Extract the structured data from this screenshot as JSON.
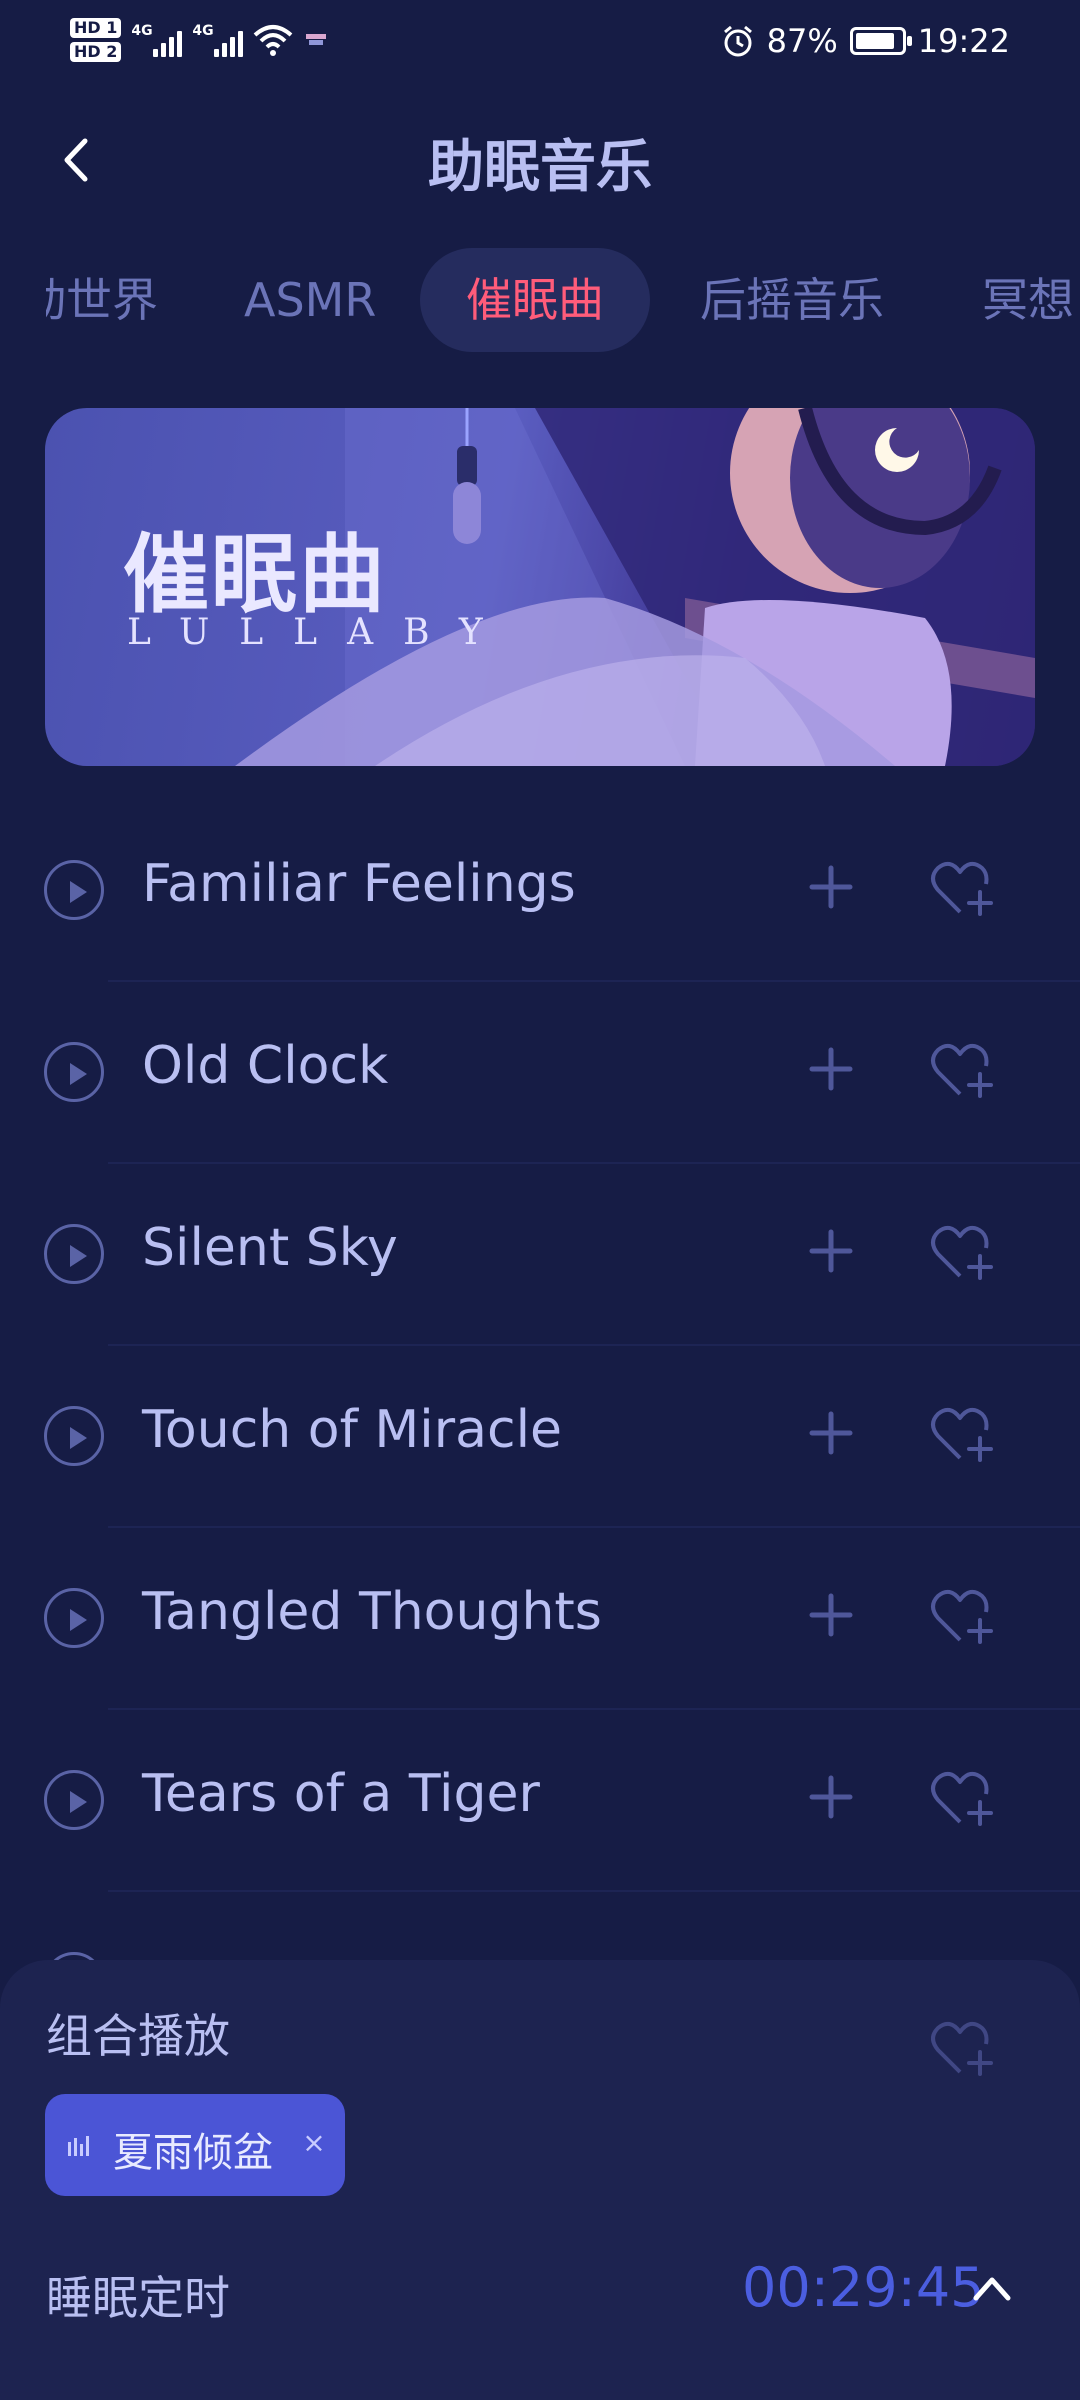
{
  "status_bar": {
    "hd1": "HD 1",
    "hd2": "HD 2",
    "net1": "4G",
    "net2": "4G",
    "battery_percent": "87%",
    "battery_level": 0.87,
    "time": "19:22"
  },
  "header": {
    "title": "助眠音乐"
  },
  "tabs": [
    {
      "label": "动世界"
    },
    {
      "label": "ASMR"
    },
    {
      "label": "催眠曲",
      "active": true
    },
    {
      "label": "后摇音乐"
    },
    {
      "label": "冥想"
    }
  ],
  "banner": {
    "title": "催眠曲",
    "subtitle": "LULLABY"
  },
  "songs": [
    {
      "title": "Familiar Feelings"
    },
    {
      "title": "Old Clock"
    },
    {
      "title": "Silent Sky"
    },
    {
      "title": "Touch of Miracle"
    },
    {
      "title": "Tangled Thoughts"
    },
    {
      "title": "Tears of a Tiger"
    }
  ],
  "combo_panel": {
    "label": "组合播放",
    "chip_label": "夏雨倾盆",
    "chip_close": "×",
    "timer_label": "睡眠定时",
    "timer_value": "00:29:45"
  },
  "colors": {
    "background": "#161c45",
    "accent_tab": "#ff5c7a",
    "chip": "#4b55d6",
    "timer": "#4b5ee0"
  },
  "icons": {
    "back": "chevron-left-icon",
    "play": "play-circle-icon",
    "add": "plus-icon",
    "favorite": "heart-plus-icon",
    "chip_equalizer": "equalizer-icon",
    "timer_toggle": "chevron-up-icon"
  }
}
